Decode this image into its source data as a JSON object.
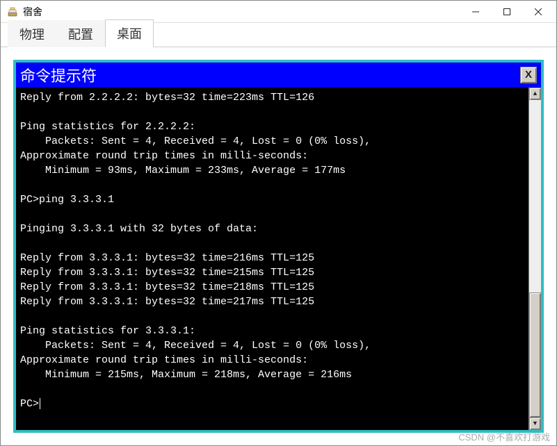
{
  "window": {
    "title": "宿舍"
  },
  "tabs": {
    "items": [
      "物理",
      "配置",
      "桌面"
    ],
    "active_index": 2
  },
  "terminal": {
    "title": "命令提示符",
    "close_label": "X",
    "lines": [
      "Reply from 2.2.2.2: bytes=32 time=223ms TTL=126",
      "",
      "Ping statistics for 2.2.2.2:",
      "    Packets: Sent = 4, Received = 4, Lost = 0 (0% loss),",
      "Approximate round trip times in milli-seconds:",
      "    Minimum = 93ms, Maximum = 233ms, Average = 177ms",
      "",
      "PC>ping 3.3.3.1",
      "",
      "Pinging 3.3.3.1 with 32 bytes of data:",
      "",
      "Reply from 3.3.3.1: bytes=32 time=216ms TTL=125",
      "Reply from 3.3.3.1: bytes=32 time=215ms TTL=125",
      "Reply from 3.3.3.1: bytes=32 time=218ms TTL=125",
      "Reply from 3.3.3.1: bytes=32 time=217ms TTL=125",
      "",
      "Ping statistics for 3.3.3.1:",
      "    Packets: Sent = 4, Received = 4, Lost = 0 (0% loss),",
      "Approximate round trip times in milli-seconds:",
      "    Minimum = 215ms, Maximum = 218ms, Average = 216ms",
      ""
    ],
    "prompt": "PC>"
  },
  "watermark": "CSDN @不喜欢打游戏"
}
